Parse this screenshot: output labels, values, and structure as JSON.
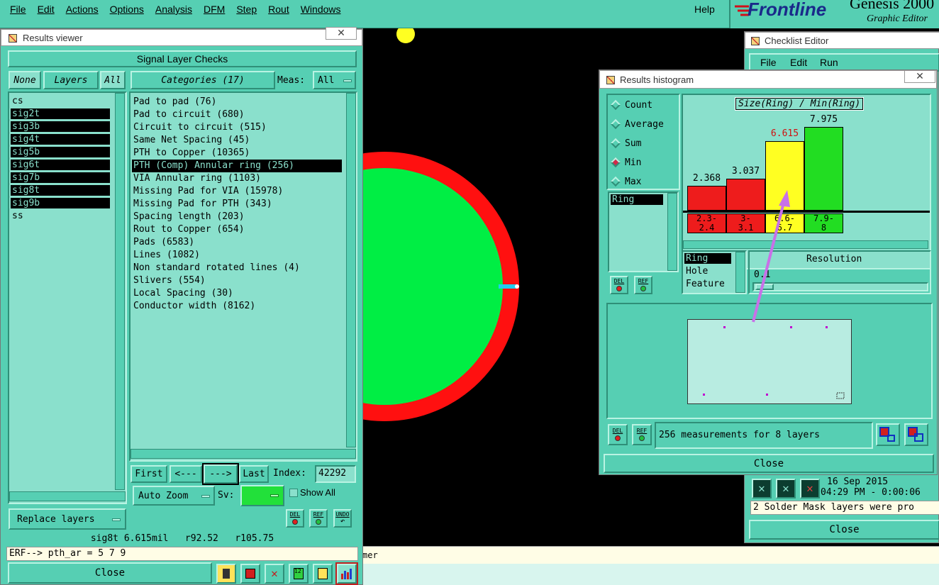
{
  "menubar": {
    "items": [
      "File",
      "Edit",
      "Actions",
      "Options",
      "Analysis",
      "DFM",
      "Step",
      "Rout",
      "Windows"
    ],
    "help": "Help",
    "brand": "Frontline",
    "product": "Genesis 2000",
    "subtitle": "Graphic Editor"
  },
  "results_viewer": {
    "title": "Results viewer",
    "header": "Signal Layer Checks",
    "none_btn": "None",
    "layers_label": "Layers",
    "all_btn": "All",
    "categories_label": "Categories (17)",
    "meas_label": "Meas:",
    "meas_value": "All",
    "layers": [
      {
        "name": "cs",
        "selected": false
      },
      {
        "name": "sig2t",
        "selected": true
      },
      {
        "name": "sig3b",
        "selected": true
      },
      {
        "name": "sig4t",
        "selected": true
      },
      {
        "name": "sig5b",
        "selected": true
      },
      {
        "name": "sig6t",
        "selected": true
      },
      {
        "name": "sig7b",
        "selected": true
      },
      {
        "name": "sig8t",
        "selected": true
      },
      {
        "name": "sig9b",
        "selected": true
      },
      {
        "name": "ss",
        "selected": false
      }
    ],
    "categories": [
      {
        "label": "Pad to pad (76)",
        "selected": false
      },
      {
        "label": "Pad to circuit (680)",
        "selected": false
      },
      {
        "label": "Circuit to circuit (515)",
        "selected": false
      },
      {
        "label": "Same Net Spacing (45)",
        "selected": false
      },
      {
        "label": "PTH to Copper (10365)",
        "selected": false
      },
      {
        "label": "PTH (Comp) Annular ring (256)",
        "selected": true
      },
      {
        "label": "VIA Annular ring (1103)",
        "selected": false
      },
      {
        "label": "Missing Pad for VIA (15978)",
        "selected": false
      },
      {
        "label": "Missing Pad for PTH (343)",
        "selected": false
      },
      {
        "label": "Spacing length (203)",
        "selected": false
      },
      {
        "label": "Rout to Copper (654)",
        "selected": false
      },
      {
        "label": "Pads (6583)",
        "selected": false
      },
      {
        "label": "Lines (1082)",
        "selected": false
      },
      {
        "label": "Non standard rotated lines (4)",
        "selected": false
      },
      {
        "label": "Slivers (554)",
        "selected": false
      },
      {
        "label": "Local Spacing (30)",
        "selected": false
      },
      {
        "label": "Conductor width (8162)",
        "selected": false
      }
    ],
    "nav": {
      "first": "First",
      "prev": "<---",
      "next": "--->",
      "last": "Last",
      "index_label": "Index:",
      "index_value": "42292"
    },
    "auto_zoom": "Auto Zoom",
    "sv_label": "Sv:",
    "show_all": "Show All",
    "replace_layers": "Replace layers",
    "del": "DEL",
    "ref": "REF",
    "undo": "UNDO",
    "status": "sig8t 6.615mil   r92.52   r105.75",
    "erf": "ERF--> pth_ar = 5 7 9",
    "close": "Close"
  },
  "checklist_editor": {
    "title": "Checklist Editor",
    "menu": [
      "File",
      "Edit",
      "Run"
    ],
    "date": "16 Sep 2015",
    "time": "04:29 PM - 0:00:06",
    "message": "2 Solder Mask layers were pro",
    "close": "Close"
  },
  "histogram": {
    "title": "Results histogram",
    "modes": [
      {
        "label": "Count",
        "selected": false
      },
      {
        "label": "Average",
        "selected": false
      },
      {
        "label": "Sum",
        "selected": false
      },
      {
        "label": "Min",
        "selected": true
      },
      {
        "label": "Max",
        "selected": false
      }
    ],
    "list_top": [
      "Ring"
    ],
    "chart_title": "Size(Ring) / Min(Ring)",
    "list_bottom": [
      "Ring",
      "Hole",
      "Feature"
    ],
    "resolution_label": "Resolution",
    "resolution_value": "0.1",
    "summary": "256 measurements for 8 layers",
    "del": "DEL",
    "ref": "REF",
    "close": "Close"
  },
  "chart_data": {
    "type": "bar",
    "title": "Size(Ring) / Min(Ring)",
    "categories": [
      "2.3-2.4",
      "3-3.1",
      "6.6-6.7",
      "7.9-8"
    ],
    "values": [
      2.368,
      3.037,
      6.615,
      7.975
    ],
    "value_labels": [
      "2.368",
      "3.037",
      "6.615",
      "7.975"
    ],
    "bin_labels": [
      [
        "2.3-",
        "2.4"
      ],
      [
        "3-",
        "3.1"
      ],
      [
        "6.6-",
        "6.7"
      ],
      [
        "7.9-",
        "8"
      ]
    ],
    "colors": [
      "#ee1c1c",
      "#ee1c1c",
      "#ffff22",
      "#22dd22"
    ],
    "ylim": [
      0,
      8.4
    ]
  },
  "canvas": {
    "partial_text": "mer"
  },
  "colors": {
    "panel": "#56cfb3",
    "panel_light": "#8ae0cc",
    "ring": "#ff1010",
    "pad": "#00ee44",
    "highlight": "#ffff22"
  }
}
